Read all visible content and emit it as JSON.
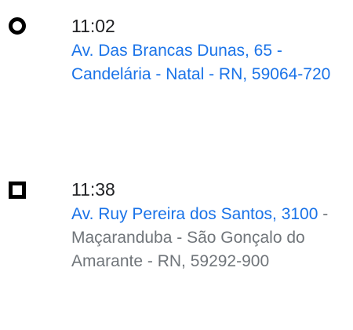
{
  "origin": {
    "time": "11:02",
    "address_link": "Av. Das Brancas Dunas, 65 - Candelária - Natal - RN, 59064-720",
    "icon": "origin-circle-icon"
  },
  "destination": {
    "time": "11:38",
    "address_link": "Av. Ruy Pereira dos Santos, 3100",
    "address_rest": " - Maçaranduba - São Gonçalo do Amarante - RN, 59292-900",
    "icon": "destination-square-icon"
  },
  "colors": {
    "link": "#1a73e8",
    "text": "#202124",
    "secondary": "#70757a"
  }
}
